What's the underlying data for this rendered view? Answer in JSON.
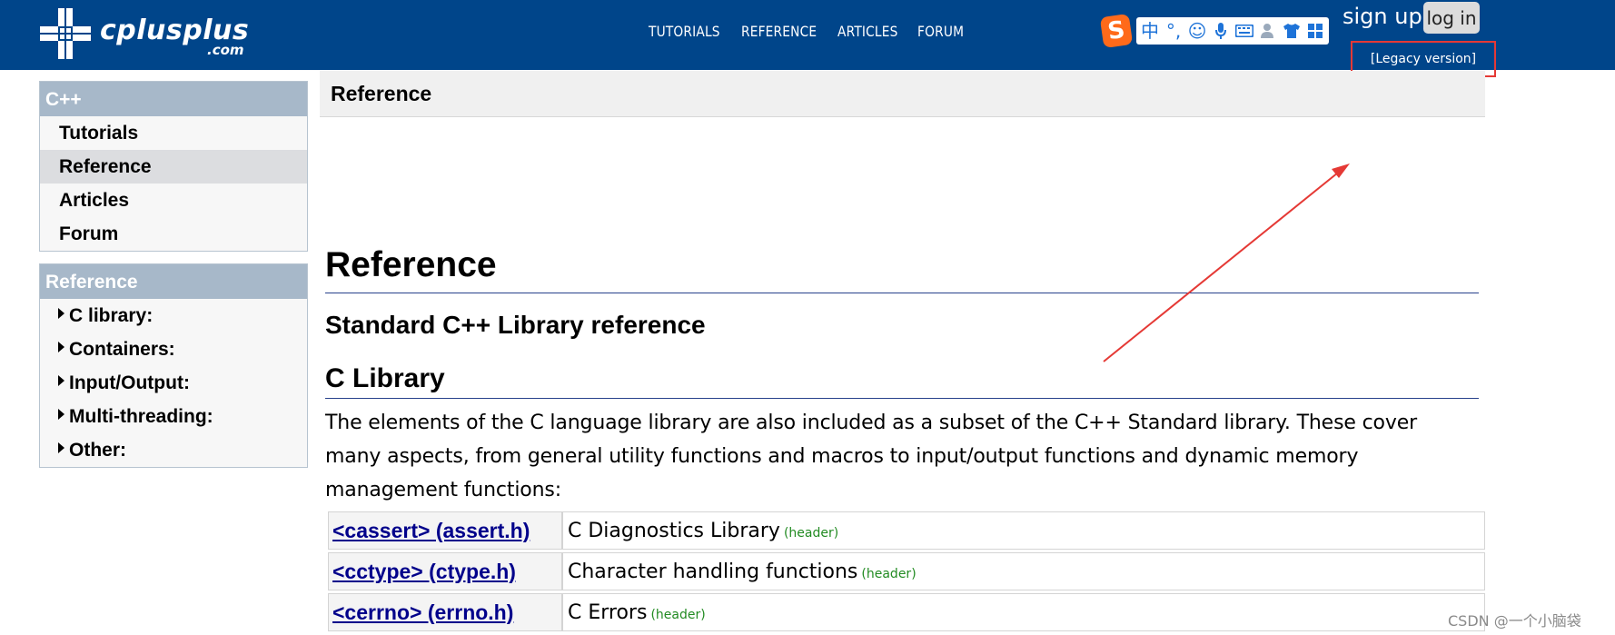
{
  "site": {
    "logo_text": "cplusplus",
    "logo_sub": ".com"
  },
  "topnav": {
    "items": [
      {
        "label": "TUTORIALS"
      },
      {
        "label": "REFERENCE"
      },
      {
        "label": "ARTICLES"
      },
      {
        "label": "FORUM"
      }
    ]
  },
  "ime_toolbar": {
    "badge": "S",
    "glyphs": [
      "中",
      "°,",
      "☺",
      "mic-icon",
      "keyboard-icon",
      "user-icon",
      "shirt-icon",
      "grid-icon"
    ]
  },
  "account": {
    "signup_label": "sign up",
    "login_label": "log in",
    "legacy_label": "[Legacy version]"
  },
  "sidebar": {
    "cpp_box": {
      "title": "C++",
      "items": [
        {
          "label": "Tutorials",
          "active": false
        },
        {
          "label": "Reference",
          "active": true
        },
        {
          "label": "Articles",
          "active": false
        },
        {
          "label": "Forum",
          "active": false
        }
      ]
    },
    "ref_box": {
      "title": "Reference",
      "items": [
        {
          "label": "C library:"
        },
        {
          "label": "Containers:"
        },
        {
          "label": "Input/Output:"
        },
        {
          "label": "Multi-threading:"
        },
        {
          "label": "Other:"
        }
      ]
    }
  },
  "main": {
    "breadcrumb": "Reference",
    "title": "Reference",
    "subtitle": "Standard C++ Library reference",
    "section_title": "C Library",
    "description": "The elements of the C language library are also included as a subset of the C++ Standard library. These cover many aspects, from general utility functions and macros to input/output functions and dynamic memory management functions:",
    "headers": [
      {
        "name": "<cassert> (assert.h)",
        "desc": "C Diagnostics Library",
        "tag": "(header)"
      },
      {
        "name": "<cctype> (ctype.h)",
        "desc": "Character handling functions",
        "tag": "(header)"
      },
      {
        "name": "<cerrno> (errno.h)",
        "desc": "C Errors",
        "tag": "(header)"
      }
    ]
  },
  "annotation": {
    "color": "#e53935"
  },
  "watermark": "CSDN @一个小脑袋",
  "colors": {
    "topbar": "#00458a",
    "sidebar_head": "#a7b8c9",
    "link": "#00008b",
    "tag": "#228b22"
  }
}
